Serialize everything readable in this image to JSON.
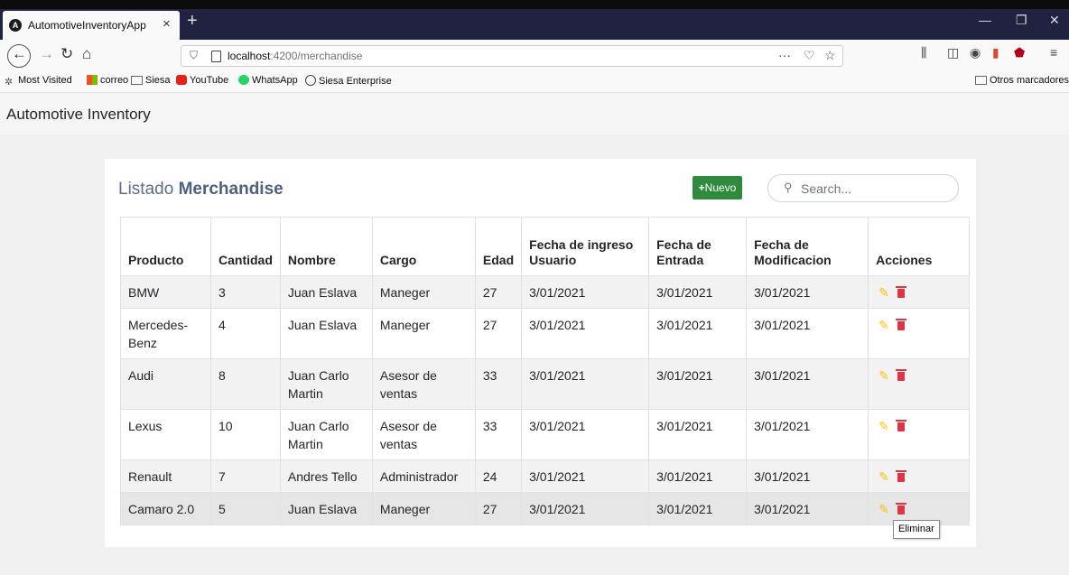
{
  "browser": {
    "tab_title": "AutomotiveInventoryApp",
    "tab_close": "×",
    "new_tab": "+",
    "url_host": "localhost",
    "url_path": ":4200/merchandise",
    "url_more": "···",
    "window_minimize": "—",
    "window_restore": "❐",
    "window_close": "✕",
    "bookmarks": [
      {
        "label": "Most Visited",
        "icon": "gear-icon"
      },
      {
        "label": "correo",
        "icon": "windows-logo-icon"
      },
      {
        "label": "Siesa",
        "icon": "folder-icon"
      },
      {
        "label": "YouTube",
        "icon": "youtube-icon"
      },
      {
        "label": "WhatsApp",
        "icon": "whatsapp-icon"
      },
      {
        "label": "Siesa Enterprise",
        "icon": "globe-icon"
      }
    ],
    "other_bookmarks": "Otros marcadores"
  },
  "app": {
    "title": "Automotive Inventory"
  },
  "list": {
    "title_prefix": "Listado",
    "title_entity": "Merchandise",
    "new_button": "Nuevo",
    "new_button_icon": "+",
    "search_placeholder": "Search..."
  },
  "table": {
    "headers": [
      "Producto",
      "Cantidad",
      "Nombre",
      "Cargo",
      "Edad",
      "Fecha de ingreso Usuario",
      "Fecha de Entrada",
      "Fecha de Modificacion",
      "Acciones"
    ],
    "rows": [
      [
        "BMW",
        "3",
        "Juan Eslava",
        "Maneger",
        "27",
        "3/01/2021",
        "3/01/2021",
        "3/01/2021"
      ],
      [
        "Mercedes-Benz",
        "4",
        "Juan Eslava",
        "Maneger",
        "27",
        "3/01/2021",
        "3/01/2021",
        "3/01/2021"
      ],
      [
        "Audi",
        "8",
        "Juan Carlo Martin",
        "Asesor de ventas",
        "33",
        "3/01/2021",
        "3/01/2021",
        "3/01/2021"
      ],
      [
        "Lexus",
        "10",
        "Juan Carlo Martin",
        "Asesor de ventas",
        "33",
        "3/01/2021",
        "3/01/2021",
        "3/01/2021"
      ],
      [
        "Renault",
        "7",
        "Andres Tello",
        "Administrador",
        "24",
        "3/01/2021",
        "3/01/2021",
        "3/01/2021"
      ],
      [
        "Camaro 2.0",
        "5",
        "Juan Eslava",
        "Maneger",
        "27",
        "3/01/2021",
        "3/01/2021",
        "3/01/2021"
      ]
    ],
    "edit_icon": "✎",
    "edit_color": "#ffc107",
    "delete_color": "#dc3545"
  },
  "tooltip": {
    "text": "Eliminar"
  },
  "colors": {
    "accent_green": "#2e8b3d",
    "title_blue": "#5b6e8c"
  }
}
